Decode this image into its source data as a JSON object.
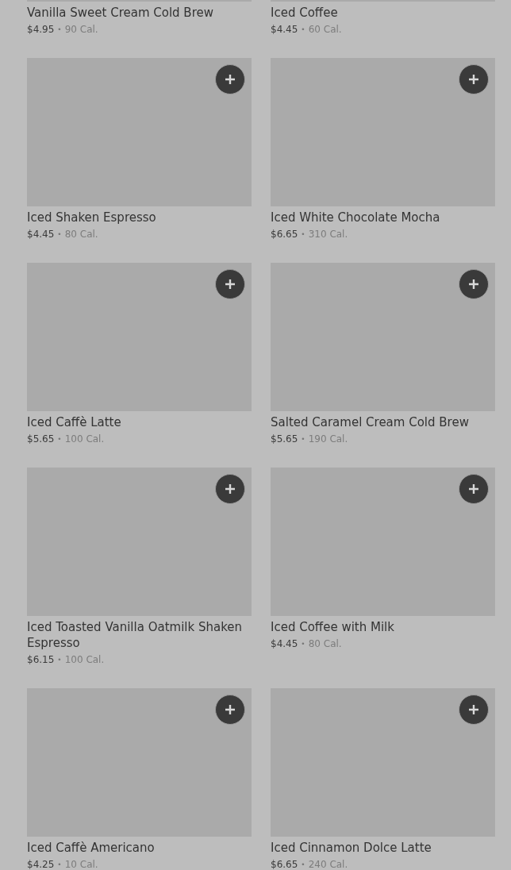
{
  "cut_off_items": [
    {
      "name": "Vanilla Sweet Cream Cold Brew",
      "price": "$4.95",
      "separator": "•",
      "calories": "90 Cal."
    },
    {
      "name": "Iced Coffee",
      "price": "$4.45",
      "separator": "•",
      "calories": "60 Cal."
    }
  ],
  "items": [
    {
      "name": "Iced Shaken Espresso",
      "price": "$4.45",
      "separator": "•",
      "calories": "80 Cal."
    },
    {
      "name": "Iced White Chocolate Mocha",
      "price": "$6.65",
      "separator": "•",
      "calories": "310 Cal."
    },
    {
      "name": "Iced Caffè Latte",
      "price": "$5.65",
      "separator": "•",
      "calories": "100 Cal."
    },
    {
      "name": "Salted Caramel Cream Cold Brew",
      "price": "$5.65",
      "separator": "•",
      "calories": "190 Cal."
    },
    {
      "name": "Iced Toasted Vanilla Oatmilk Shaken Espresso",
      "price": "$6.15",
      "separator": "•",
      "calories": "100 Cal."
    },
    {
      "name": "Iced Coffee with Milk",
      "price": "$4.45",
      "separator": "•",
      "calories": "80 Cal."
    },
    {
      "name": "Iced Caffè Americano",
      "price": "$4.25",
      "separator": "•",
      "calories": "10 Cal."
    },
    {
      "name": "Iced Cinnamon Dolce Latte",
      "price": "$6.65",
      "separator": "•",
      "calories": "240 Cal."
    }
  ]
}
